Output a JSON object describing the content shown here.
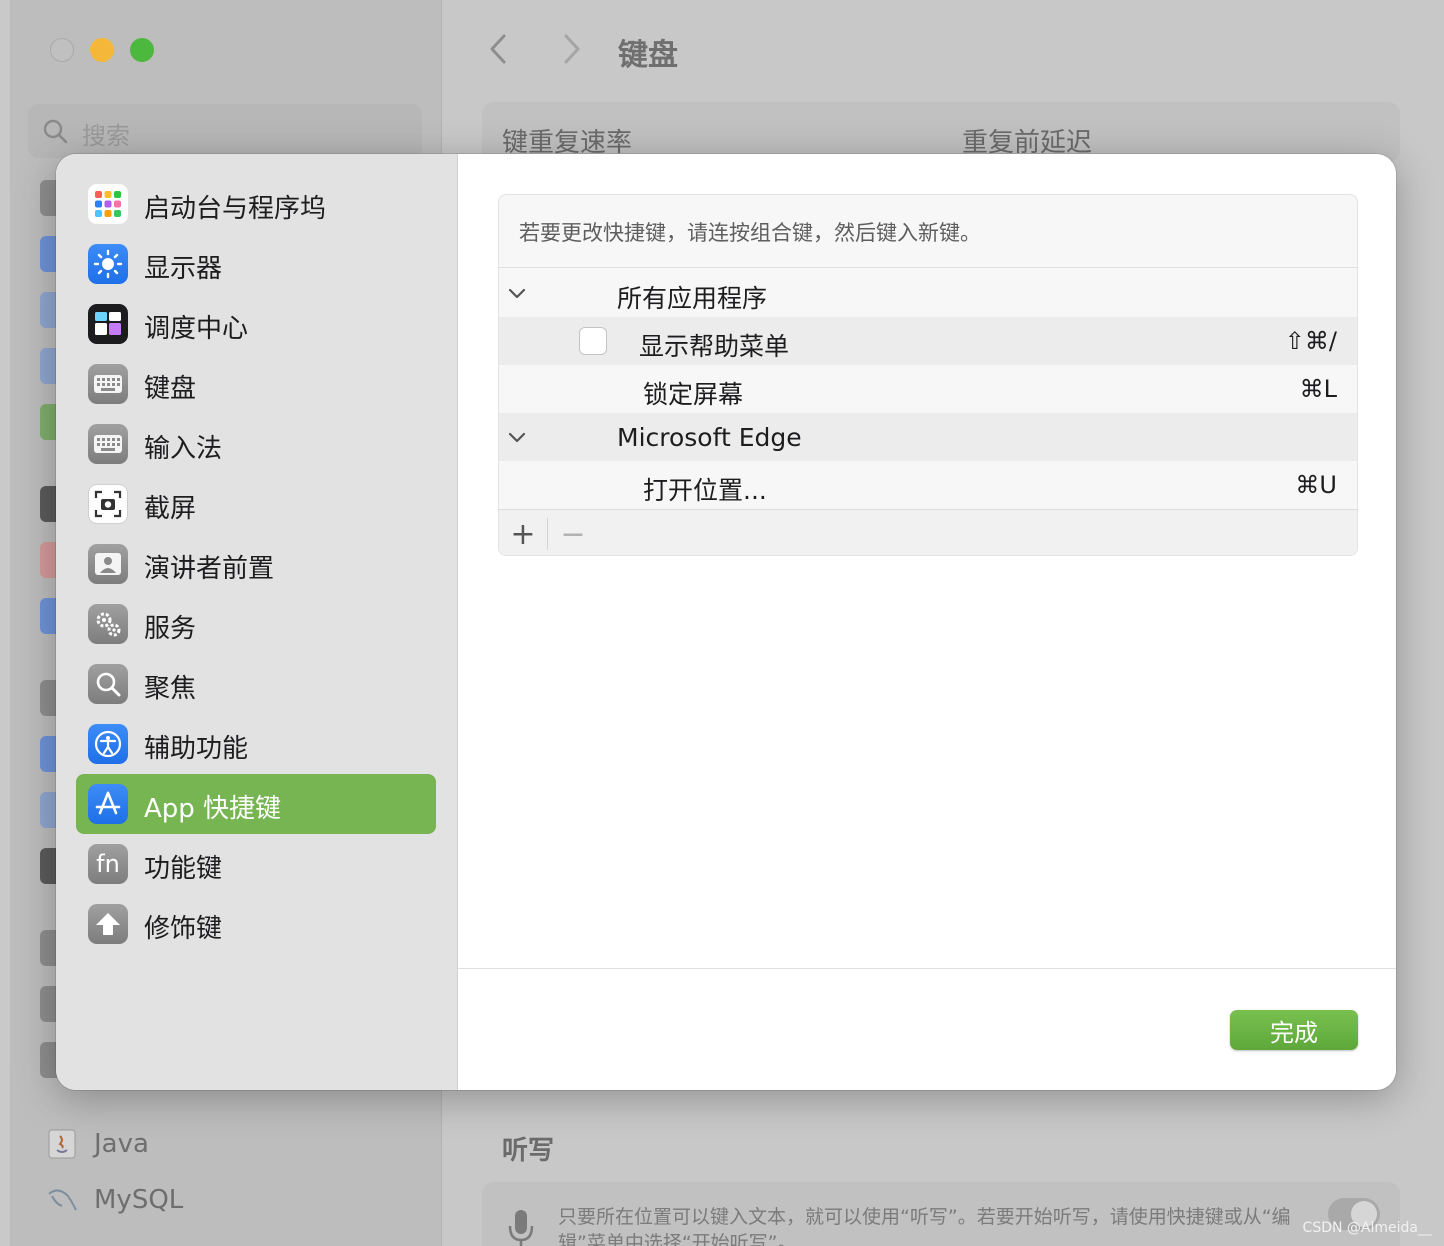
{
  "background_window": {
    "search_placeholder": "搜索",
    "title": "键盘",
    "top_card": {
      "left_label": "键重复速率",
      "right_label": "重复前延迟"
    },
    "sidebar_bottom": [
      {
        "label": "Java",
        "icon": "java-icon"
      },
      {
        "label": "MySQL",
        "icon": "mysql-icon"
      }
    ],
    "dictation": {
      "section_title": "听写",
      "description": "只要所在位置可以键入文本，就可以使用“听写”。若要开始听写，请使用快捷键或从“编辑”菜单中选择“开始听写”。"
    },
    "watermark": "CSDN @Almeida__"
  },
  "modal": {
    "sidebar": [
      {
        "label": "启动台与程序坞",
        "icon": "launchpad-icon",
        "color": "#ffffff"
      },
      {
        "label": "显示器",
        "icon": "display-brightness-icon",
        "color": "#2f7ff4"
      },
      {
        "label": "调度中心",
        "icon": "mission-control-icon",
        "color": "#1c1c1e"
      },
      {
        "label": "键盘",
        "icon": "keyboard-icon",
        "color": "#9a9a9a"
      },
      {
        "label": "输入法",
        "icon": "input-source-keyboard-icon",
        "color": "#9a9a9a"
      },
      {
        "label": "截屏",
        "icon": "screenshot-camera-icon",
        "color": "#ffffff"
      },
      {
        "label": "演讲者前置",
        "icon": "presenter-overlay-icon",
        "color": "#9a9a9a"
      },
      {
        "label": "服务",
        "icon": "services-gears-icon",
        "color": "#9a9a9a"
      },
      {
        "label": "聚焦",
        "icon": "spotlight-search-icon",
        "color": "#9a9a9a"
      },
      {
        "label": "辅助功能",
        "icon": "accessibility-icon",
        "color": "#2f7ff4"
      },
      {
        "label": "App 快捷键",
        "icon": "app-store-icon",
        "color": "#2f7ff4",
        "selected": true
      },
      {
        "label": "功能键",
        "icon": "fn-key-icon",
        "color": "#9a9a9a"
      },
      {
        "label": "修饰键",
        "icon": "modifier-up-arrow-icon",
        "color": "#9a9a9a"
      }
    ],
    "hint": "若要更改快捷键，请连按组合键，然后键入新键。",
    "groups": [
      {
        "name": "所有应用程序",
        "items": [
          {
            "label": "显示帮助菜单",
            "keys": "⇧⌘/",
            "has_checkbox": true,
            "checked": false
          },
          {
            "label": "锁定屏幕",
            "keys": "⌘L"
          }
        ]
      },
      {
        "name": "Microsoft Edge",
        "items": [
          {
            "label": "打开位置...",
            "keys": "⌘U"
          }
        ]
      }
    ],
    "toolbar": {
      "add": "+",
      "remove": "−"
    },
    "done_label": "完成"
  }
}
